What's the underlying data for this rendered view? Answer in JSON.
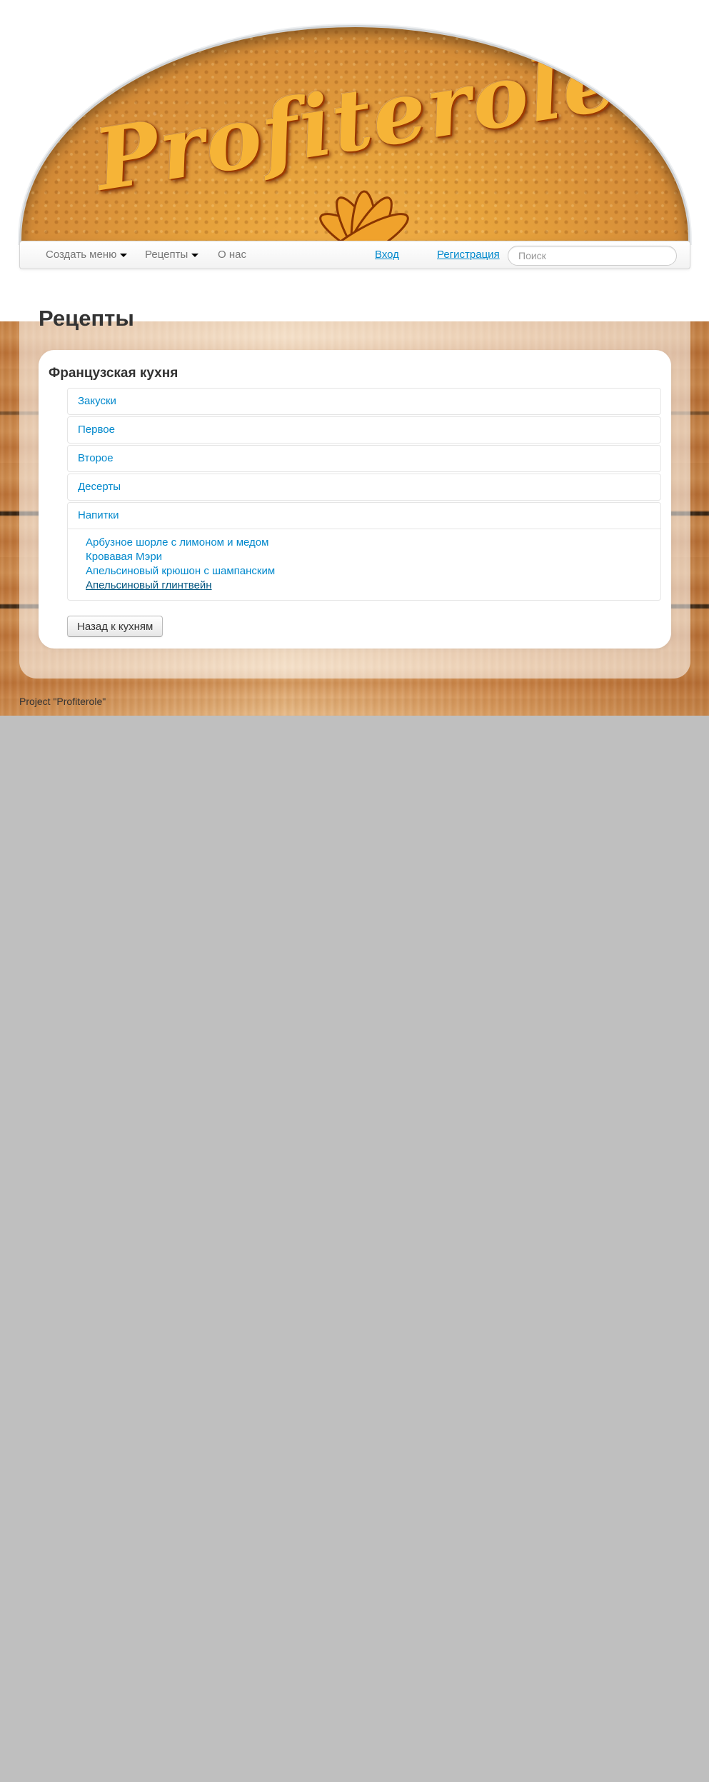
{
  "banner": {
    "logo_text": "Profiterole"
  },
  "navbar": {
    "menu_create": "Создать меню",
    "menu_recipes": "Рецепты",
    "menu_about": "О нас",
    "login": "Вход",
    "register": "Регистрация",
    "search_placeholder": "Поиск"
  },
  "page": {
    "title": "Рецепты"
  },
  "cuisine": {
    "title": "Французская кухня",
    "sections": [
      {
        "label": "Закуски"
      },
      {
        "label": "Первое"
      },
      {
        "label": "Второе"
      },
      {
        "label": "Десерты"
      },
      {
        "label": "Напитки"
      }
    ],
    "open_section_items": [
      "Арбузное шорле с лимоном и медом",
      "Кровавая Мэри",
      "Апельсиновый крюшон с шампанским",
      "Апельсиновый глинтвейн"
    ],
    "active_item_index": 3,
    "back_button": "Назад к кухням"
  },
  "footer": {
    "text": "Project \"Profiterole\""
  },
  "colors": {
    "link": "#0088cc",
    "link_active": "#005580",
    "page_bg": "#bfbfbf"
  }
}
